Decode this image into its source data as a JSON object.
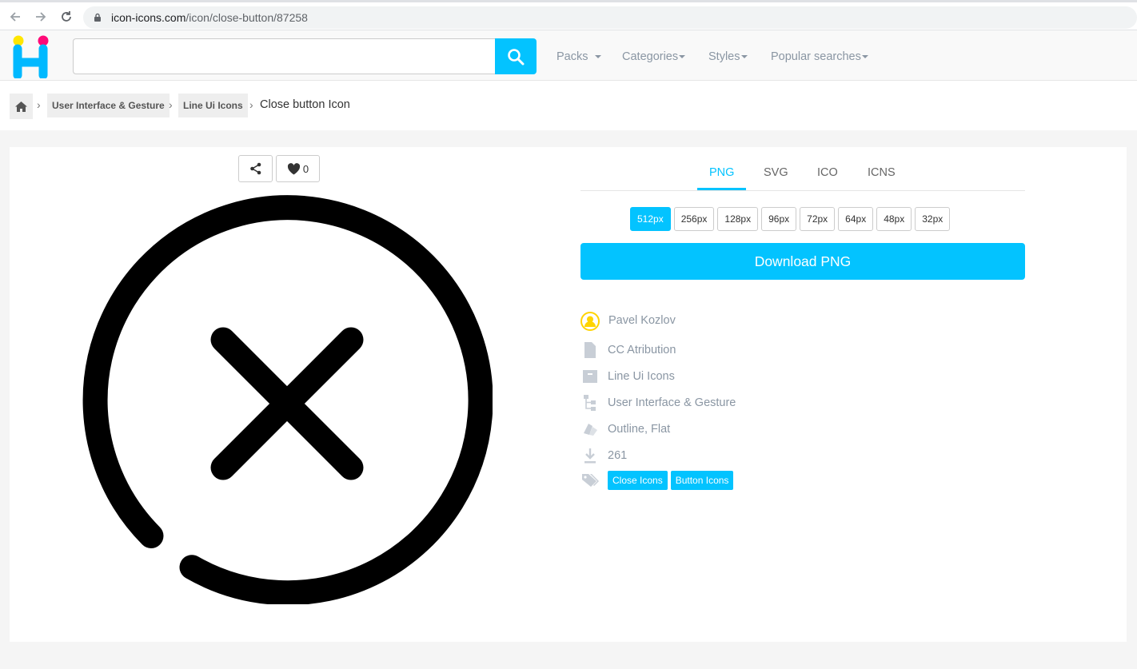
{
  "browser": {
    "url_host": "icon-icons.com",
    "url_path": "/icon/close-button/87258"
  },
  "header": {
    "search_placeholder": "",
    "menu": [
      {
        "label": "Packs"
      },
      {
        "label": "Categories"
      },
      {
        "label": "Styles"
      },
      {
        "label": "Popular searches"
      }
    ]
  },
  "breadcrumb": {
    "items": [
      "User Interface & Gesture",
      "Line Ui Icons"
    ],
    "current": "Close button Icon"
  },
  "actions": {
    "like_count": "0"
  },
  "formats": {
    "tabs": [
      "PNG",
      "SVG",
      "ICO",
      "ICNS"
    ],
    "active_tab": "PNG",
    "sizes": [
      "512px",
      "256px",
      "128px",
      "96px",
      "72px",
      "64px",
      "48px",
      "32px"
    ],
    "active_size": "512px",
    "download_label": "Download PNG"
  },
  "meta": {
    "author": "Pavel Kozlov",
    "license": "CC Atribution",
    "pack": "Line Ui Icons",
    "category": "User Interface & Gesture",
    "styles": "Outline, Flat",
    "downloads": "261",
    "tags": [
      "Close Icons",
      "Button Icons"
    ]
  },
  "colors": {
    "accent": "#03c3ff",
    "muted_text": "#8a96a3"
  }
}
